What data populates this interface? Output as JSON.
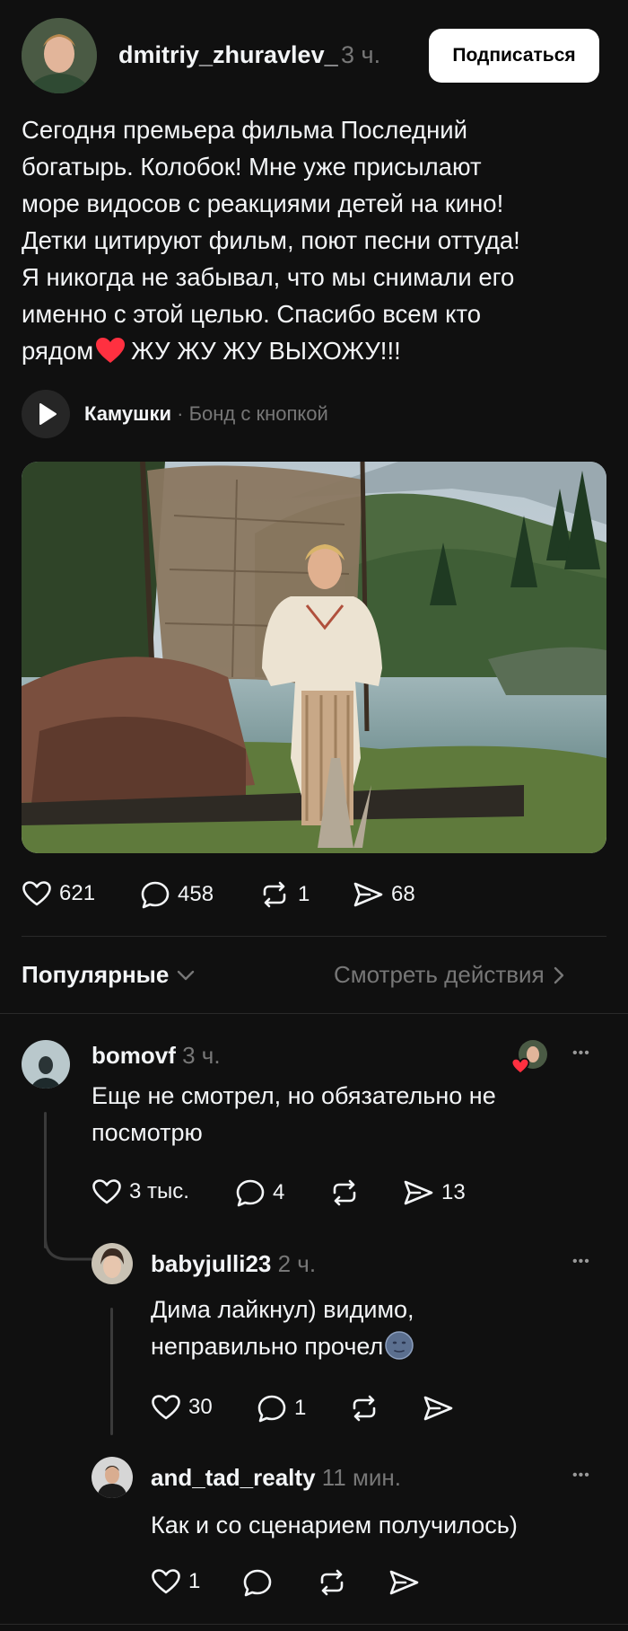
{
  "post": {
    "username": "dmitriy_zhuravlev_",
    "time": "3 ч.",
    "follow_label": "Подписаться",
    "text_lines": [
      "Сегодня премьера фильма Последний",
      "богатырь. Колобок! Мне уже присылают",
      "море видосов с реакциями детей на кино!",
      "Детки цитируют фильм, поют песни оттуда!",
      "Я никогда не забывал, что мы снимали его",
      "именно с этой целью. Спасибо всем кто",
      "рядом",
      "ЖУ ЖУ ЖУ ВЫХОЖУ!!!"
    ],
    "music": {
      "artist": "Камушки",
      "separator": "·",
      "track": "Бонд с кнопкой"
    },
    "stats": {
      "likes": "621",
      "comments": "458",
      "reposts": "1",
      "shares": "68"
    }
  },
  "filter": {
    "sort_label": "Популярные",
    "activity_label": "Смотреть действия"
  },
  "comments": [
    {
      "username": "bomovf",
      "time": "3 ч.",
      "more": "•••",
      "text_lines": [
        "Еще не смотрел, но обязательно не",
        "посмотрю"
      ],
      "likes": "3 тыс.",
      "replies": "4",
      "reposts": "",
      "shares": "13"
    },
    {
      "username": "babyjulli23",
      "time": "2 ч.",
      "more": "•••",
      "text_lines": [
        "Дима лайкнул) видимо,",
        "неправильно прочел"
      ],
      "likes": "30",
      "replies": "1",
      "reposts": "",
      "shares": ""
    },
    {
      "username": "and_tad_realty",
      "time": "11 мин.",
      "more": "•••",
      "text_lines": [
        "Как и со сценарием получилось)"
      ],
      "likes": "1",
      "replies": "",
      "reposts": "",
      "shares": ""
    }
  ],
  "colors": {
    "background": "#101010",
    "text": "#f3f5f7",
    "muted": "#777777",
    "heart": "#ff3040"
  }
}
